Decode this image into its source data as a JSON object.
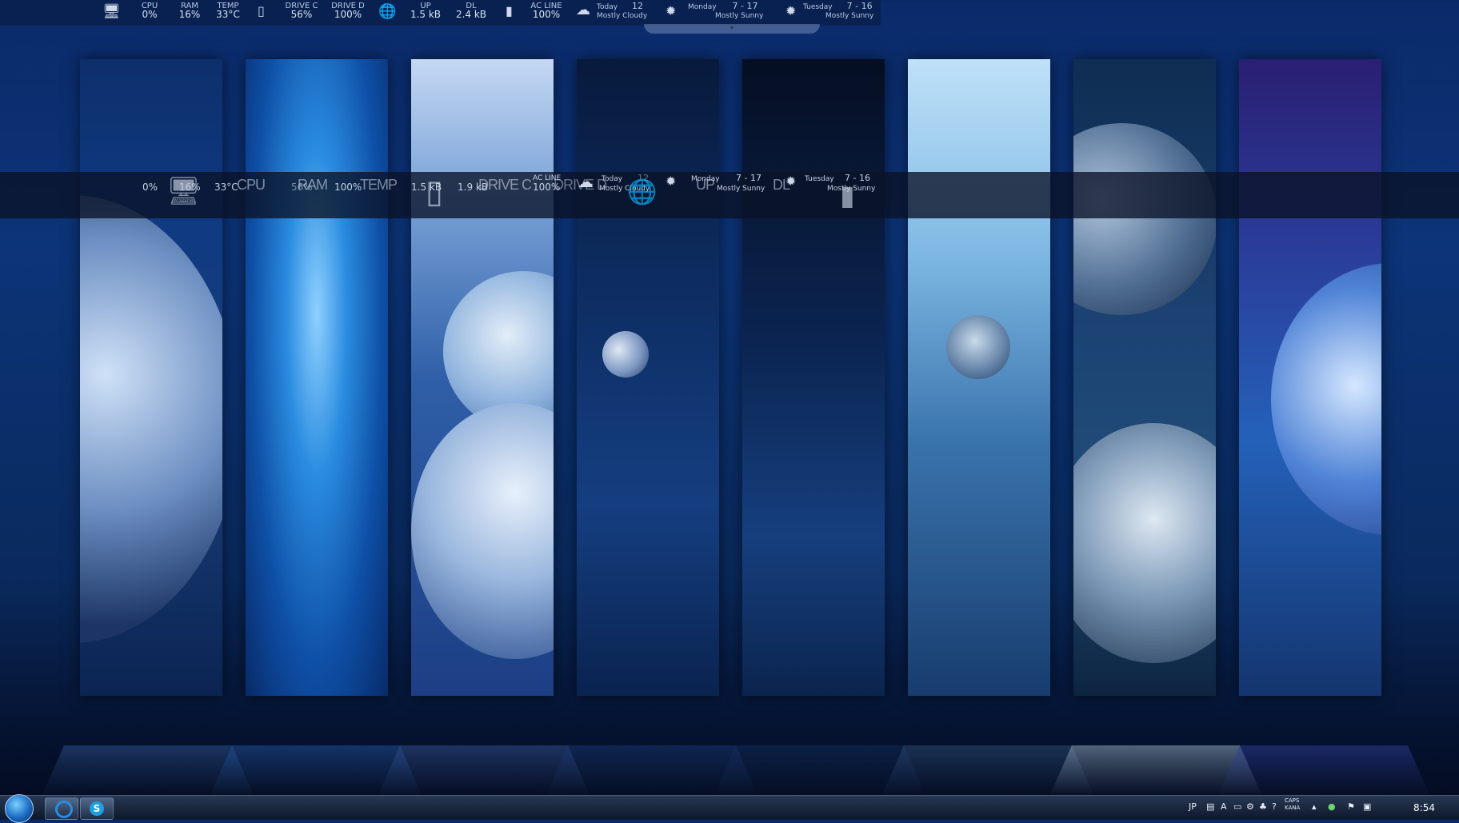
{
  "topbar": {
    "cpu_label": "CPU",
    "cpu_value": "0%",
    "ram_label": "RAM",
    "ram_value": "16%",
    "temp_label": "TEMP",
    "temp_value": "33°C",
    "drivec_label": "DRIVE C",
    "drivec_value": "56%",
    "drived_label": "DRIVE D",
    "drived_value": "100%",
    "up_label": "UP",
    "up_value": "1.5 kB",
    "dl_label": "DL",
    "dl_value": "2.4 kB",
    "acline_label": "AC LINE",
    "acline_value": "100%",
    "today_label": "Today",
    "today_temp": "12",
    "today_desc": "Mostly Cloudy",
    "monday_label": "Monday",
    "monday_temp": "7 - 17",
    "monday_desc": "Mostly Sunny",
    "tuesday_label": "Tuesday",
    "tuesday_temp": "7 - 16",
    "tuesday_desc": "Mostly Sunny",
    "handle_glyph": "▾"
  },
  "midbar": {
    "cpu_value": "0%",
    "ram_value": "16%",
    "temp_value": "33°C",
    "cpu_label": "CPU",
    "ram_label": "RAM",
    "drivec_pct": "56%",
    "drived_pct": "100%",
    "temp_label": "TEMP",
    "up_value": "1.5 kB",
    "dl_value": "1.9 kB",
    "drivec_label": "DRIVE C",
    "acline_label": "AC LINE",
    "acline_value": "100%",
    "drived_label": "DRIVE D",
    "today_label": "Today",
    "today_temp": "12",
    "today_desc": "Mostly Cloudy",
    "up_label": "UP",
    "monday_label": "Monday",
    "monday_temp": "7 - 17",
    "monday_desc": "Mostly Sunny",
    "dl_label": "DL",
    "tuesday_label": "Tuesday",
    "tuesday_temp": "7 - 16",
    "tuesday_desc": "Mostly Sunny"
  },
  "taskbar": {
    "lang": "JP",
    "caps": "CAPS",
    "kana": "KANA",
    "clock": "8:54",
    "pinned": [
      "browser-icon",
      "skype-icon"
    ]
  }
}
